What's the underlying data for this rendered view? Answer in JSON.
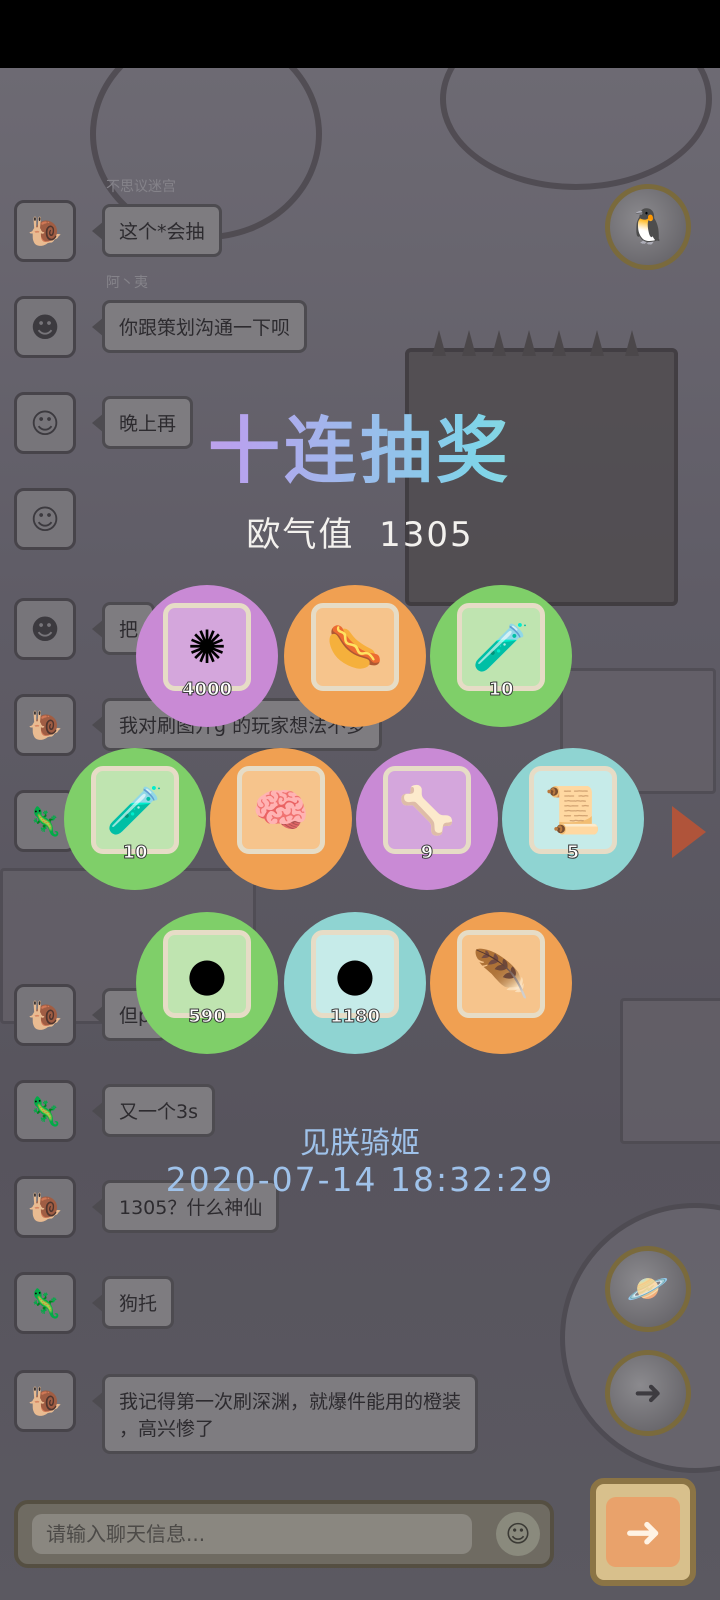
{
  "chat": {
    "messages": [
      {
        "nick": "不思议迷宫",
        "text": "这个*会抽",
        "avatar": "snail-avatar"
      },
      {
        "nick": "阿丶夷",
        "text": "你跟策划沟通一下呗",
        "avatar": "glasses-girl-avatar"
      },
      {
        "nick": "",
        "text": "晚上再",
        "avatar": "blonde-girl-avatar"
      },
      {
        "nick": "",
        "text": "",
        "avatar": "blonde-girl-avatar"
      },
      {
        "nick": "",
        "text": "把",
        "avatar": "glasses-girl-avatar"
      },
      {
        "nick": "",
        "text": "我对刷图开g  的玩家想法不多",
        "avatar": "snail-avatar"
      },
      {
        "nick": "",
        "text": "",
        "avatar": "lizard-avatar"
      },
      {
        "nick": "",
        "text": "但p",
        "avatar": "snail-avatar"
      },
      {
        "nick": "",
        "text": "又一个3s",
        "avatar": "lizard-avatar"
      },
      {
        "nick": "",
        "text": "1305？什么神仙",
        "avatar": "snail-avatar"
      },
      {
        "nick": "",
        "text": "狗托",
        "avatar": "lizard-avatar"
      },
      {
        "nick": "",
        "text": "我记得第一次刷深渊，就爆件能用的橙装\n，高兴惨了",
        "avatar": "snail-avatar"
      }
    ],
    "input_placeholder": "请输入聊天信息..."
  },
  "lottery": {
    "title": "十连抽奖",
    "luck_label": "欧气值",
    "luck_value": "1305",
    "winner": "见朕骑姬",
    "datetime": "2020-07-14  18:32:29",
    "prizes": [
      {
        "icon": "spiky-shell-icon",
        "glyph": "✺",
        "count": "4000",
        "rarity": "purple"
      },
      {
        "icon": "sausage-icon",
        "glyph": "🌭",
        "count": "",
        "rarity": "orange"
      },
      {
        "icon": "potion-bottle-icon",
        "glyph": "🧪",
        "count": "10",
        "rarity": "green"
      },
      {
        "icon": "potion-bottle-icon",
        "glyph": "🧪",
        "count": "10",
        "rarity": "green"
      },
      {
        "icon": "brain-icon",
        "glyph": "🧠",
        "count": "",
        "rarity": "orange"
      },
      {
        "icon": "bone-scroll-icon",
        "glyph": "🦴",
        "count": "9",
        "rarity": "purple"
      },
      {
        "icon": "scroll-icon",
        "glyph": "📜",
        "count": "5",
        "rarity": "cyan"
      },
      {
        "icon": "gray-blob-icon",
        "glyph": "●",
        "count": "590",
        "rarity": "green"
      },
      {
        "icon": "gray-blob-icon",
        "glyph": "●",
        "count": "1180",
        "rarity": "cyan"
      },
      {
        "icon": "feather-blade-icon",
        "glyph": "🪶",
        "count": "",
        "rarity": "orange"
      }
    ]
  },
  "colors": {
    "purple": "#c98ad5",
    "orange": "#f0a052",
    "green": "#7fcf69",
    "cyan": "#8fd4d2",
    "info_text": "#9fc2ea"
  }
}
